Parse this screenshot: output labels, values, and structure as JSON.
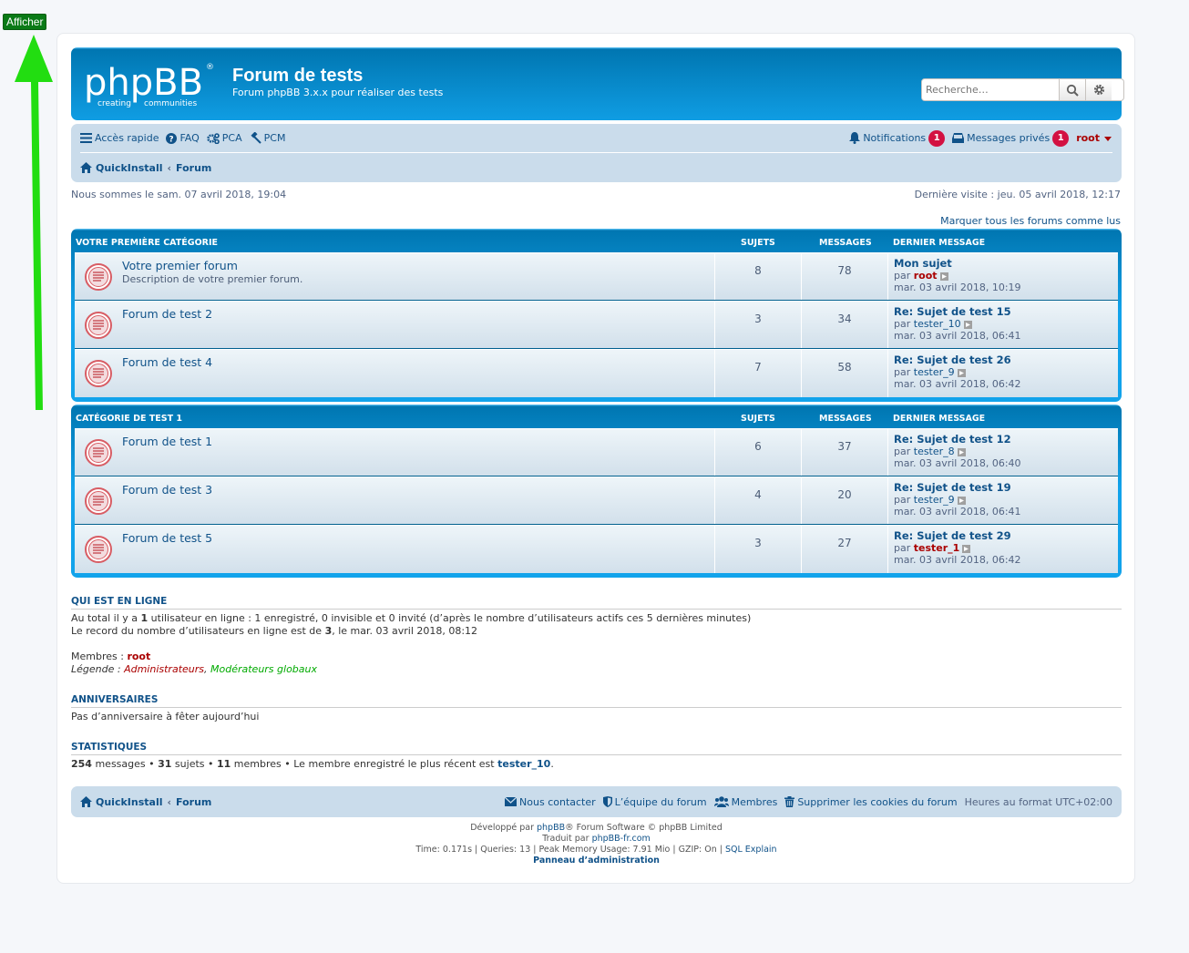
{
  "overlay": {
    "afficher_label": "Afficher"
  },
  "header": {
    "logo_text": "phpBB",
    "logo_sub1": "creating",
    "logo_sub2": "communities",
    "title": "Forum de tests",
    "description": "Forum phpBB 3.x.x pour réaliser des tests",
    "search_placeholder": "Recherche…"
  },
  "nav": {
    "quick_access": "Accès rapide",
    "faq": "FAQ",
    "pca": "PCA",
    "pcm": "PCM",
    "notifications": "Notifications",
    "notifications_count": "1",
    "pm": "Messages privés",
    "pm_count": "1",
    "username": "root",
    "breadcrumb_home": "QuickInstall",
    "breadcrumb_forum": "Forum"
  },
  "dates": {
    "current": "Nous sommes le sam. 07 avril 2018, 19:04",
    "last_visit": "Dernière visite : jeu. 05 avril 2018, 12:17"
  },
  "mark_all_read": "Marquer tous les forums comme lus",
  "columns": {
    "topics": "Sujets",
    "posts": "Messages",
    "last_post": "Dernier message"
  },
  "categories": [
    {
      "title": "Votre première catégorie",
      "forums": [
        {
          "name": "Votre premier forum",
          "desc": "Description de votre premier forum.",
          "topics": "8",
          "posts": "78",
          "last_title": "Mon sujet",
          "last_by": "par",
          "last_author": "root",
          "author_admin": true,
          "last_date": "mar. 03 avril 2018, 10:19"
        },
        {
          "name": "Forum de test 2",
          "desc": "",
          "topics": "3",
          "posts": "34",
          "last_title": "Re: Sujet de test 15",
          "last_by": "par",
          "last_author": "tester_10",
          "author_admin": false,
          "last_date": "mar. 03 avril 2018, 06:41"
        },
        {
          "name": "Forum de test 4",
          "desc": "",
          "topics": "7",
          "posts": "58",
          "last_title": "Re: Sujet de test 26",
          "last_by": "par",
          "last_author": "tester_9",
          "author_admin": false,
          "last_date": "mar. 03 avril 2018, 06:42"
        }
      ]
    },
    {
      "title": "Catégorie de test 1",
      "forums": [
        {
          "name": "Forum de test 1",
          "desc": "",
          "topics": "6",
          "posts": "37",
          "last_title": "Re: Sujet de test 12",
          "last_by": "par",
          "last_author": "tester_8",
          "author_admin": false,
          "last_date": "mar. 03 avril 2018, 06:40"
        },
        {
          "name": "Forum de test 3",
          "desc": "",
          "topics": "4",
          "posts": "20",
          "last_title": "Re: Sujet de test 19",
          "last_by": "par",
          "last_author": "tester_9",
          "author_admin": false,
          "last_date": "mar. 03 avril 2018, 06:41"
        },
        {
          "name": "Forum de test 5",
          "desc": "",
          "topics": "3",
          "posts": "27",
          "last_title": "Re: Sujet de test 29",
          "last_by": "par",
          "last_author": "tester_1",
          "author_admin": true,
          "last_date": "mar. 03 avril 2018, 06:42"
        }
      ]
    }
  ],
  "online": {
    "title": "Qui est en ligne",
    "line1_pre": "Au total il y a ",
    "line1_num": "1",
    "line1_post": " utilisateur en ligne : 1 enregistré, 0 invisible et 0 invité (d’après le nombre d’utilisateurs actifs ces 5 dernières minutes)",
    "line2_pre": "Le record du nombre d’utilisateurs en ligne est de ",
    "line2_num": "3",
    "line2_post": ", le mar. 03 avril 2018, 08:12",
    "members_label": "Membres : ",
    "members_value": "root",
    "legend_label": "Légende : ",
    "legend_admin": "Administrateurs",
    "legend_sep": ", ",
    "legend_gmod": "Modérateurs globaux"
  },
  "birthdays": {
    "title": "Anniversaires",
    "text": "Pas d’anniversaire à fêter aujourd’hui"
  },
  "statistics": {
    "title": "Statistiques",
    "posts_num": "254",
    "posts_label": " messages • ",
    "topics_num": "31",
    "topics_label": " sujets • ",
    "members_num": "11",
    "members_label": " membres • Le membre enregistré le plus récent est ",
    "newest": "tester_10",
    "end": "."
  },
  "footer": {
    "home": "QuickInstall",
    "forum": "Forum",
    "contact": "Nous contacter",
    "team": "L’équipe du forum",
    "members": "Membres",
    "cookies": "Supprimer les cookies du forum",
    "timezone": "Heures au format UTC+02:00",
    "powered_pre": "Développé par ",
    "powered_link": "phpBB",
    "powered_post": "® Forum Software © phpBB Limited",
    "translated_pre": "Traduit par ",
    "translated_link": "phpBB-fr.com",
    "debug": "Time: 0.171s | Queries: 13 | Peak Memory Usage: 7.91 Mio | GZIP: On | ",
    "sql_explain": "SQL Explain",
    "admin_panel": "Panneau d’administration"
  }
}
